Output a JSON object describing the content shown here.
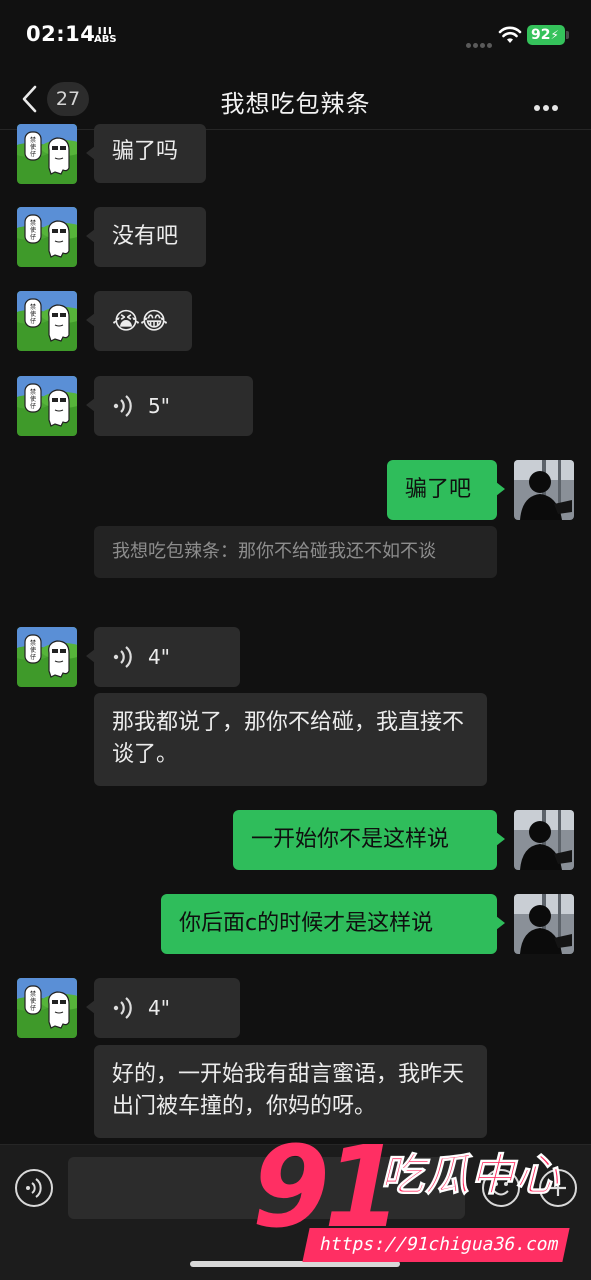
{
  "status_bar": {
    "time": "02:14",
    "abs_label": "ABS",
    "battery": "92"
  },
  "header": {
    "back_count": "27",
    "title": "我想吃包辣条"
  },
  "messages": {
    "m1": {
      "text": "骗了吗"
    },
    "m2": {
      "text": "没有吧"
    },
    "m3": {
      "text": "😭😂"
    },
    "m4": {
      "duration": "5\""
    },
    "m5": {
      "text": "骗了吧"
    },
    "quote": {
      "text": "我想吃包辣条：那你不给碰我还不如不谈"
    },
    "m6": {
      "duration": "4\""
    },
    "m7": {
      "text": "那我都说了，那你不给碰，我直接不谈了。"
    },
    "m8": {
      "text": "一开始你不是这样说"
    },
    "m9": {
      "text": "你后面c的时候才是这样说"
    },
    "m10": {
      "duration": "4\""
    },
    "m11": {
      "text": "好的，一开始我有甜言蜜语，我昨天出门被车撞的，你妈的呀。"
    }
  },
  "avatar": {
    "left_sign_text": "禁使仔"
  },
  "input": {
    "value": ""
  },
  "watermark": {
    "number": "91",
    "name": "吃瓜中心",
    "url": "https://91chigua36.com"
  }
}
